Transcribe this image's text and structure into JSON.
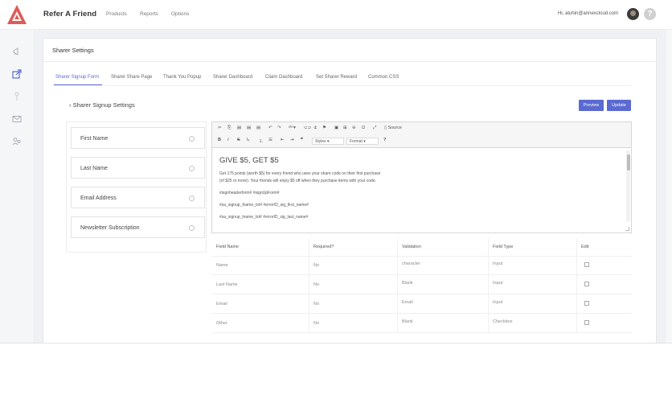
{
  "header": {
    "app_title": "Refer A Friend",
    "nav": [
      "Products",
      "Reports",
      "Options"
    ],
    "greeting": "Hi, atuhin@annexcloud.com",
    "help_label": "?"
  },
  "card": {
    "title": "Sharer Settings",
    "tabs": [
      "Sharer Signup Form",
      "Sharer Share Page",
      "Thank You Popup",
      "Sharer Dashboard",
      "Claim Dashboard",
      "Set Sharer Reward",
      "Common CSS"
    ],
    "active_tab": "Sharer Signup Form",
    "back_label": "Sharer Signup Settings",
    "preview_label": "Preview",
    "update_label": "Update"
  },
  "fields": [
    "First Name",
    "Last Name",
    "Email Address",
    "Newsletter Subscription"
  ],
  "editor": {
    "toolbar_source": "Source",
    "styles_select": "Styles",
    "format_select": "Format",
    "heading": "GIVE $5, GET $5",
    "line1": "Get 175 points (worth $5) for every friend who uses your share code on their first purchase",
    "line2": "(of $25 or more). Your friends will enjoy $5 off when they purchase items with your code.",
    "line3": "#signheaderform# #signUpForm#",
    "line4": "#sa_signup_fname_txt# #errorID_sig_first_name#",
    "line5": "#sa_signup_lname_txt# #errorID_sig_last_name#"
  },
  "table": {
    "headers": [
      "Field Name",
      "Required?",
      "Validation",
      "Field Type",
      "Edit"
    ],
    "rows": [
      [
        "Name",
        "No",
        "character",
        "Input"
      ],
      [
        "Last Name",
        "No",
        "Blank",
        "Input"
      ],
      [
        "Email",
        "No",
        "Email",
        "Input"
      ],
      [
        "Other",
        "No",
        "Blank",
        "Checkbox"
      ]
    ]
  },
  "colors": {
    "accent": "#5b6ad0",
    "logo": "#e05a5a"
  },
  "icons": {
    "sidebar": [
      "megaphone-icon",
      "share-icon",
      "user-icon",
      "mail-icon",
      "users-icon"
    ],
    "field_settings": "gear-icon",
    "row_edit": "edit-icon"
  }
}
